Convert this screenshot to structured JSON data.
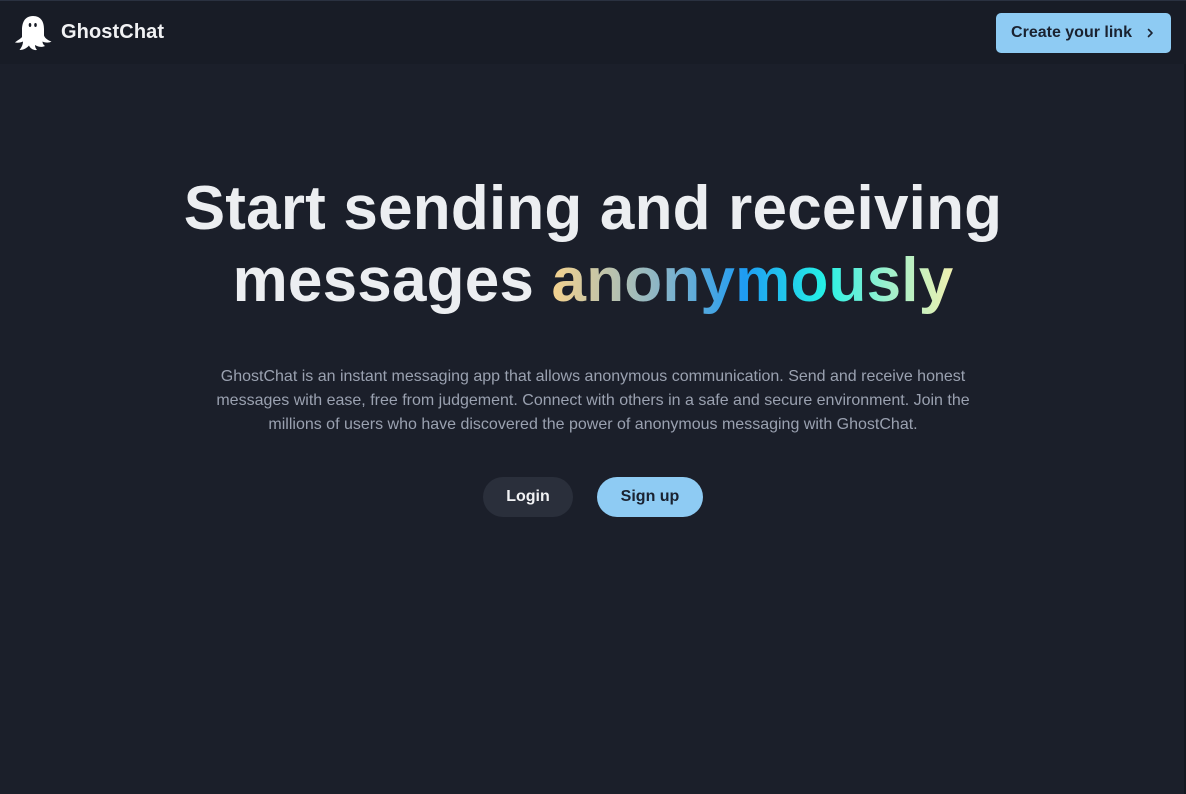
{
  "brand": {
    "name": "GhostChat",
    "logo_icon": "ghost-icon"
  },
  "header": {
    "cta_label": "Create your link",
    "cta_icon": "chevron-right-icon"
  },
  "hero": {
    "headline_line1": "Start sending and receiving",
    "headline_line2_prefix": "messages ",
    "headline_highlight": "anonymously",
    "description": "GhostChat is an instant messaging app that allows anonymous communication. Send and receive honest messages with ease, free from judgement. Connect with others in a safe and secure environment. Join the millions of users who have discovered the power of anonymous messaging with GhostChat.",
    "login_label": "Login",
    "signup_label": "Sign up"
  },
  "colors": {
    "background": "#1b1f2a",
    "navbar": "#181c26",
    "accent": "#8ecbf3",
    "muted_text": "#9aa1b0",
    "secondary_button": "#2a2f3b"
  }
}
